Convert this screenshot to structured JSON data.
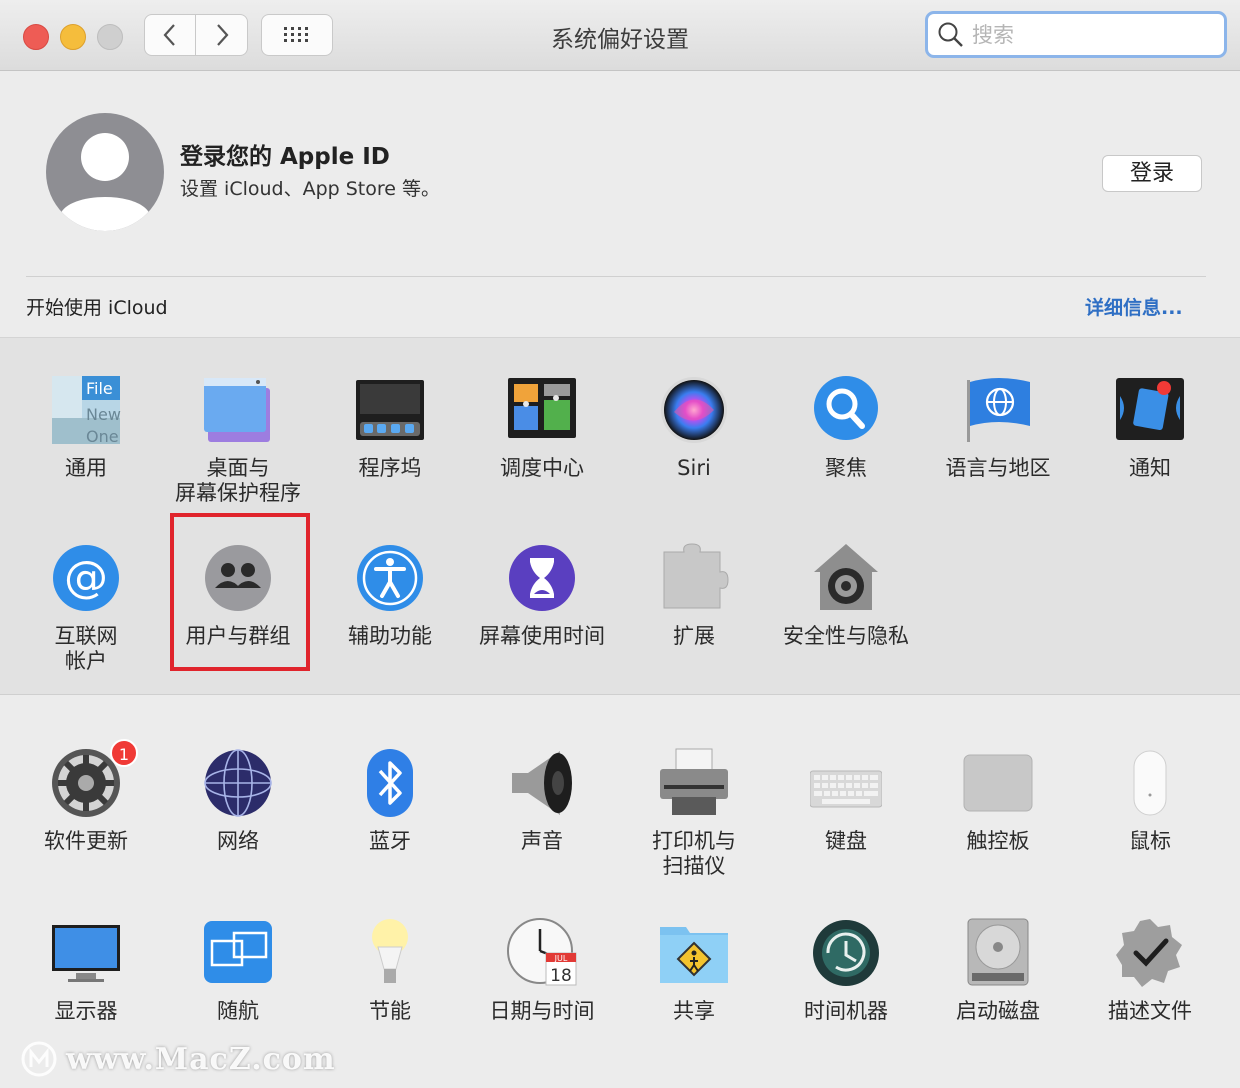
{
  "window": {
    "title": "系统偏好设置"
  },
  "search": {
    "placeholder": "搜索"
  },
  "account": {
    "title": "登录您的 Apple ID",
    "subtitle": "设置 iCloud、App Store 等。",
    "signin_label": "登录",
    "icloud_text": "开始使用 iCloud",
    "details_link": "详细信息..."
  },
  "row1": [
    {
      "name": "general",
      "label": "通用",
      "icon": "general-icon"
    },
    {
      "name": "desktop-screensaver",
      "label": "桌面与\n屏幕保护程序",
      "icon": "desktop-icon"
    },
    {
      "name": "dock",
      "label": "程序坞",
      "icon": "dock-icon"
    },
    {
      "name": "mission-control",
      "label": "调度中心",
      "icon": "mission-control-icon"
    },
    {
      "name": "siri",
      "label": "Siri",
      "icon": "siri-icon"
    },
    {
      "name": "spotlight",
      "label": "聚焦",
      "icon": "spotlight-icon"
    },
    {
      "name": "language-region",
      "label": "语言与地区",
      "icon": "flag-icon"
    },
    {
      "name": "notifications",
      "label": "通知",
      "icon": "notifications-icon"
    }
  ],
  "row2": [
    {
      "name": "internet-accounts",
      "label": "互联网\n帐户",
      "icon": "at-icon"
    },
    {
      "name": "users-groups",
      "label": "用户与群组",
      "icon": "users-icon"
    },
    {
      "name": "accessibility",
      "label": "辅助功能",
      "icon": "accessibility-icon"
    },
    {
      "name": "screen-time",
      "label": "屏幕使用时间",
      "icon": "hourglass-icon"
    },
    {
      "name": "extensions",
      "label": "扩展",
      "icon": "puzzle-icon"
    },
    {
      "name": "security-privacy",
      "label": "安全性与隐私",
      "icon": "house-lock-icon"
    }
  ],
  "row3": [
    {
      "name": "software-update",
      "label": "软件更新",
      "icon": "gear-icon",
      "badge": "1"
    },
    {
      "name": "network",
      "label": "网络",
      "icon": "globe-icon"
    },
    {
      "name": "bluetooth",
      "label": "蓝牙",
      "icon": "bluetooth-icon"
    },
    {
      "name": "sound",
      "label": "声音",
      "icon": "speaker-icon"
    },
    {
      "name": "printers-scanners",
      "label": "打印机与\n扫描仪",
      "icon": "printer-icon"
    },
    {
      "name": "keyboard",
      "label": "键盘",
      "icon": "keyboard-icon"
    },
    {
      "name": "trackpad",
      "label": "触控板",
      "icon": "trackpad-icon"
    },
    {
      "name": "mouse",
      "label": "鼠标",
      "icon": "mouse-icon"
    }
  ],
  "row4": [
    {
      "name": "displays",
      "label": "显示器",
      "icon": "display-icon"
    },
    {
      "name": "sidecar",
      "label": "随航",
      "icon": "sidecar-icon"
    },
    {
      "name": "energy-saver",
      "label": "节能",
      "icon": "lightbulb-icon"
    },
    {
      "name": "date-time",
      "label": "日期与时间",
      "icon": "clock-icon",
      "cal_month": "JUL",
      "cal_day": "18"
    },
    {
      "name": "sharing",
      "label": "共享",
      "icon": "sharing-folder-icon"
    },
    {
      "name": "time-machine",
      "label": "时间机器",
      "icon": "time-machine-icon"
    },
    {
      "name": "startup-disk",
      "label": "启动磁盘",
      "icon": "disk-icon"
    },
    {
      "name": "profiles",
      "label": "描述文件",
      "icon": "checkmark-badge-icon"
    }
  ],
  "general_icon_text": [
    "File",
    "New",
    "One"
  ],
  "watermark": "www.MacZ.com",
  "colors": {
    "highlight": "#e0242c",
    "link": "#2f6fc4",
    "badge": "#f03a36"
  }
}
